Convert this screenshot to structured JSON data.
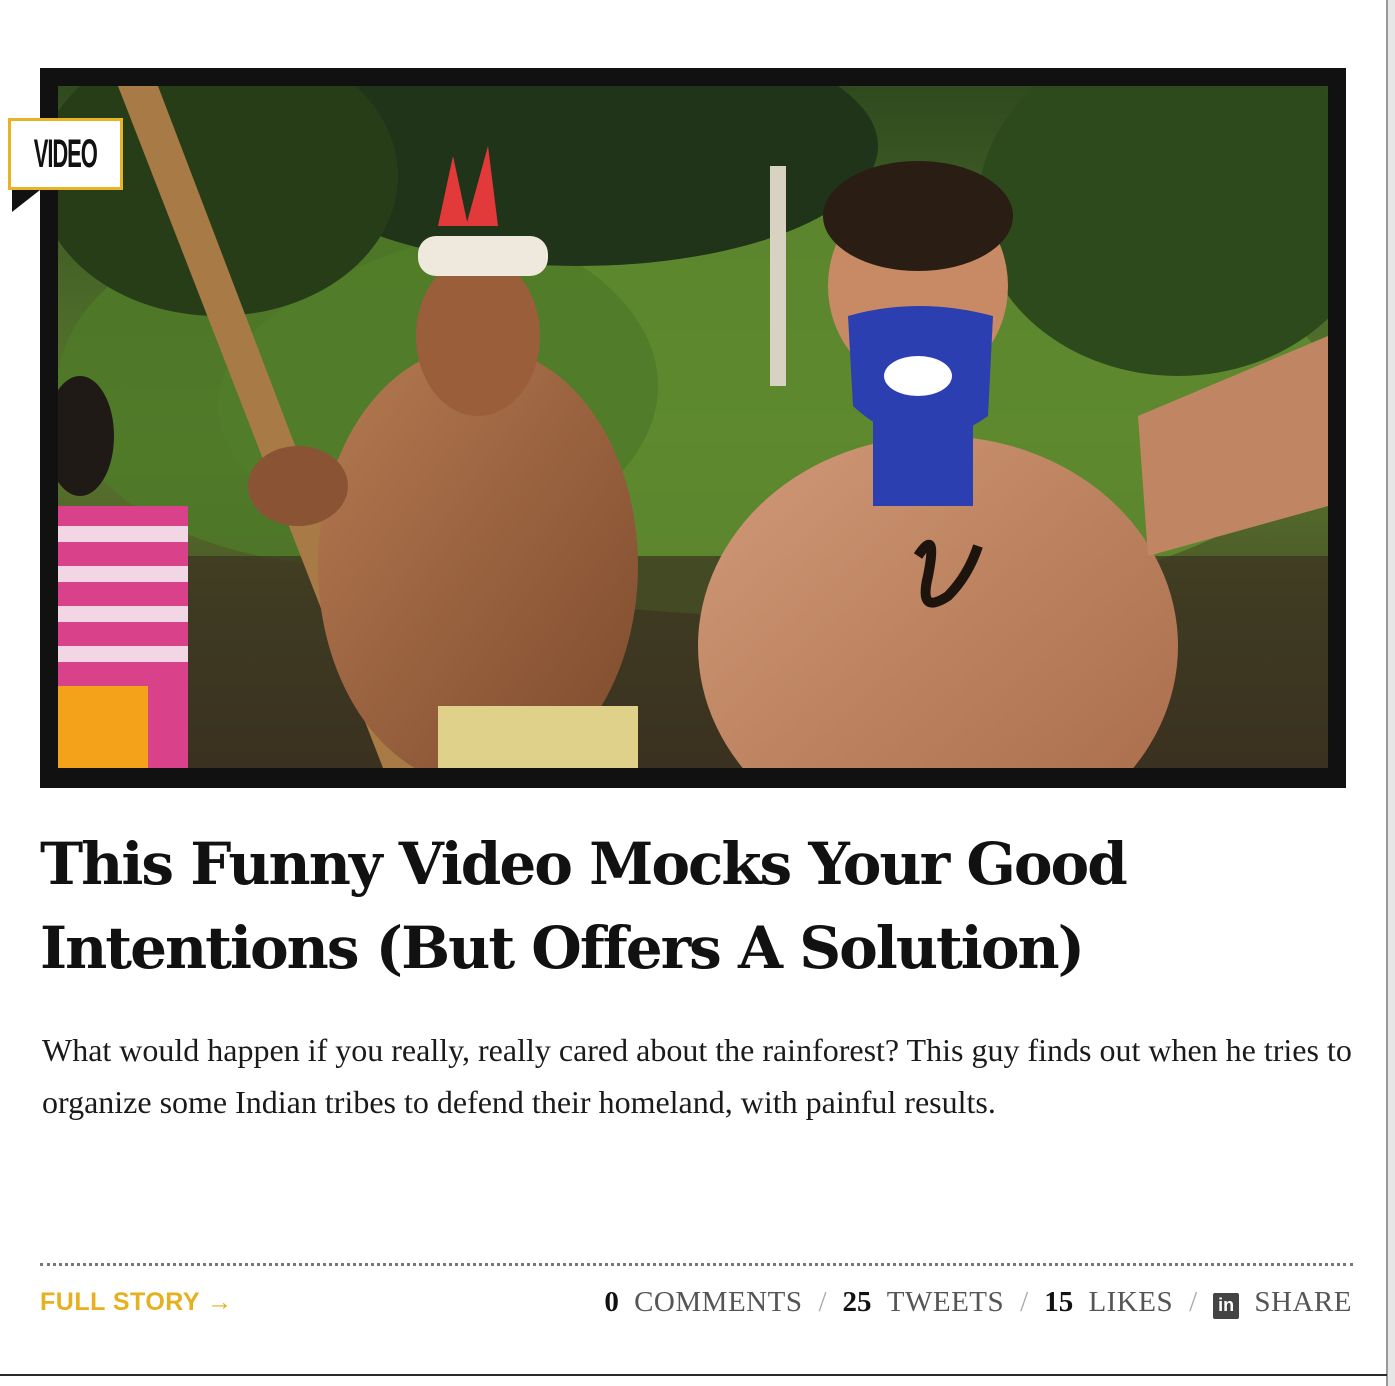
{
  "badge": {
    "label": "VIDEO"
  },
  "article": {
    "title": "This Funny Video Mocks Your Good Intentions (But Offers A Solution)",
    "dek": "What would happen if you really, really cared about the rainforest? This guy finds out when he tries to organize some Indian tribes to defend their homeland, with painful results."
  },
  "footer": {
    "full_story": "FULL STORY →",
    "comments_count": "0",
    "comments_label": "COMMENTS",
    "tweets_count": "25",
    "tweets_label": "TWEETS",
    "likes_count": "15",
    "likes_label": "LIKES",
    "share_icon": "in",
    "share_label": "SHARE",
    "separator": "/"
  },
  "colors": {
    "accent": "#e6b01f",
    "badge_border": "#e8b423"
  },
  "icons": [
    "linkedin-icon",
    "arrow-right-icon"
  ]
}
